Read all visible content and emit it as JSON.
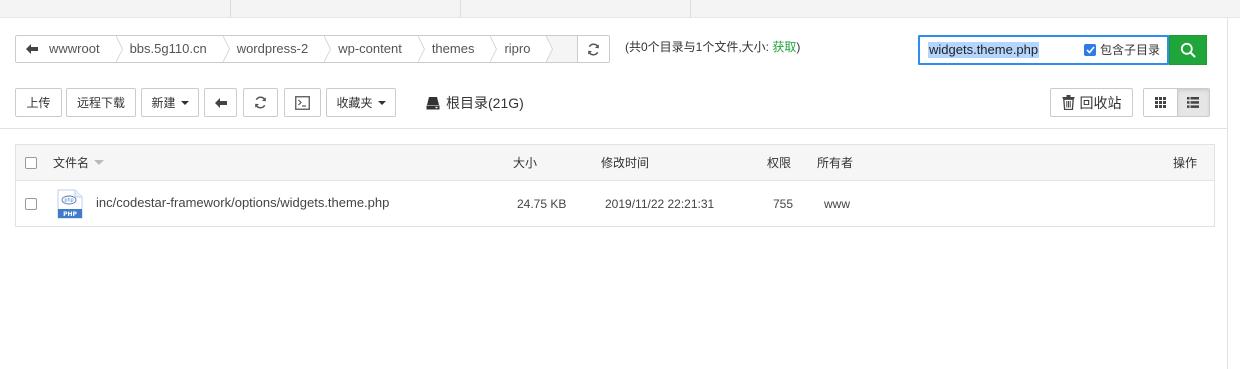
{
  "breadcrumb": {
    "items": [
      "wwwroot",
      "bbs.5g110.cn",
      "wordpress-2",
      "wp-content",
      "themes",
      "ripro",
      ""
    ]
  },
  "summary": {
    "text": "(共0个目录与1个文件,大小: ",
    "link": "获取",
    "close": ")"
  },
  "search": {
    "value": "widgets.theme.php",
    "subdir_label": "包含子目录",
    "subdir_checked": true
  },
  "toolbar": {
    "upload": "上传",
    "remote_download": "远程下载",
    "new": "新建",
    "favorites": "收藏夹",
    "root_dir": "根目录(21G)",
    "recycle_bin": "回收站"
  },
  "table": {
    "headers": {
      "name": "文件名",
      "size": "大小",
      "modified": "修改时间",
      "perm": "权限",
      "owner": "所有者",
      "actions": "操作"
    },
    "rows": [
      {
        "icon": "php-file-icon",
        "name": "inc/codestar-framework/options/widgets.theme.php",
        "size": "24.75 KB",
        "modified": "2019/11/22 22:21:31",
        "perm": "755",
        "owner": "www"
      }
    ]
  },
  "colors": {
    "accent_green": "#20a53a",
    "search_border": "#2e8ded",
    "checkbox_blue": "#2f7ae5"
  }
}
